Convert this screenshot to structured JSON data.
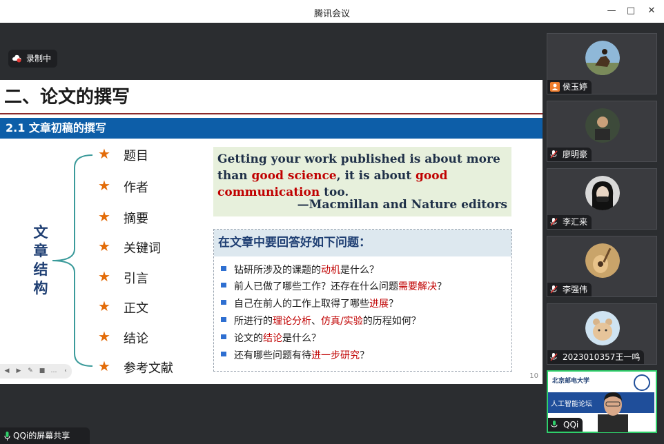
{
  "window": {
    "title": "腾讯会议",
    "controls": [
      "minimize-icon",
      "maximize-icon",
      "close-icon"
    ]
  },
  "recording": {
    "label": "录制中"
  },
  "slide": {
    "title": "二、论文的撰写",
    "subtitle": "2.1  文章初稿的撰写",
    "vertical_label": [
      "文",
      "章",
      "结",
      "构"
    ],
    "outline_items": [
      "题目",
      "作者",
      "摘要",
      "关键词",
      "引言",
      "正文",
      "结论",
      "参考文献"
    ],
    "quote": {
      "part1": "Getting your work published is about more than",
      "red1": "good science",
      "part2": ", it is about",
      "red2": "good communication",
      "part3": "too.",
      "attribution": "—Macmillan and Nature editors"
    },
    "questions_header": "在文章中要回答好如下问题：",
    "questions": [
      {
        "pre": "钻研所涉及的课题的",
        "hl": "动机",
        "post": "是什么？"
      },
      {
        "pre": "前人已做了哪些工作？还存在什么问题",
        "hl": "需要解决",
        "post": "？"
      },
      {
        "pre": "自己在前人的工作上取得了哪些",
        "hl": "进展",
        "post": "？"
      },
      {
        "pre": "所进行的",
        "hl": "理论分析",
        "mid": "、",
        "hl2": "仿真/实验",
        "post": "的历程如何？"
      },
      {
        "pre": "论文的",
        "hl": "结论",
        "post": "是什么？"
      },
      {
        "pre": "还有哪些问题有待",
        "hl": "进一步研究",
        "post": "？"
      }
    ],
    "page_number": "10"
  },
  "screen_share": {
    "label": "QQi的屏幕共享"
  },
  "participants": [
    {
      "name": "侯玉婷",
      "muted": false
    },
    {
      "name": "廖明豪",
      "muted": true
    },
    {
      "name": "李汇来",
      "muted": true
    },
    {
      "name": "李强伟",
      "muted": true
    },
    {
      "name": "2023010357王一鸣",
      "muted": true
    },
    {
      "name": "QQi",
      "muted": false,
      "speaking": true,
      "video_band_text": "人工智能论坛",
      "logo_text": "北京邮电大学"
    }
  ],
  "colors": {
    "accent_blue": "#0d5ea8",
    "highlight_red": "#c00000",
    "star_orange": "#e36c09",
    "speaking_green": "#2fd06b"
  }
}
